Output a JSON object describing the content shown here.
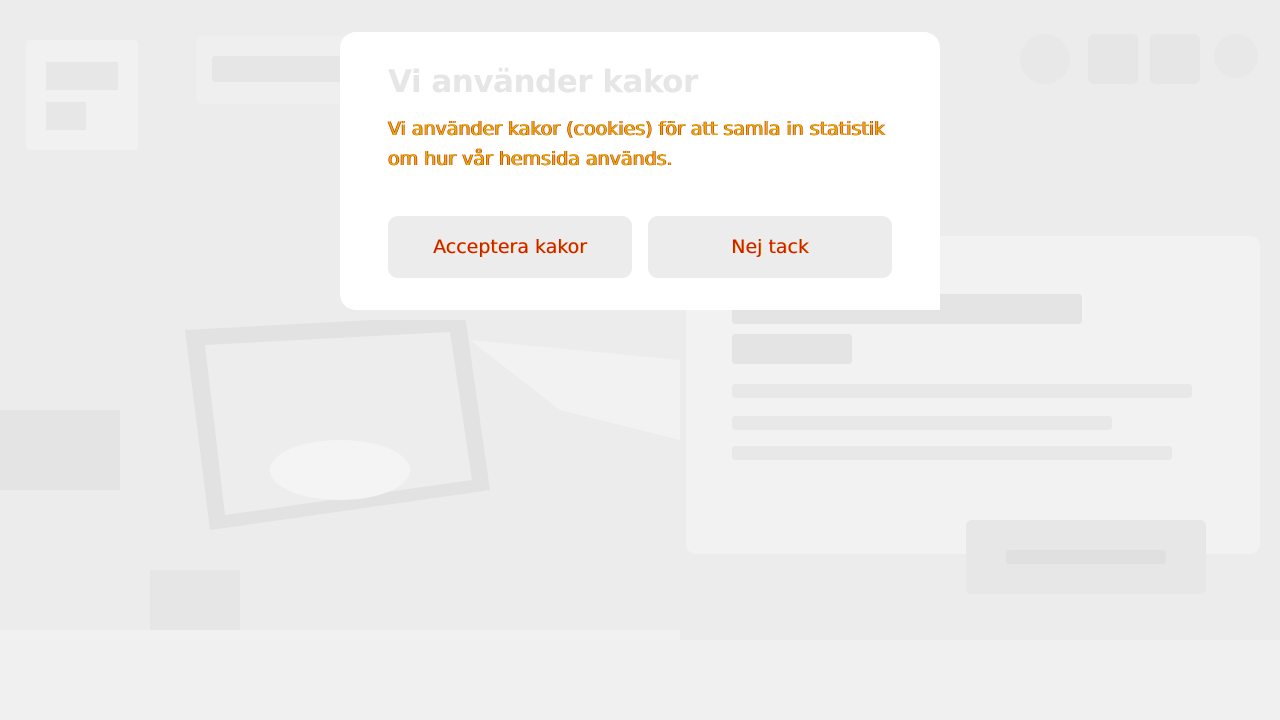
{
  "cookie_dialog": {
    "title": "Vi använder kakor",
    "text": "Vi använder kakor (cookies) för att samla in statistik om hur vår hemsida används.",
    "accept_label": "Acceptera kakor",
    "decline_label": "Nej tack"
  },
  "colors": {
    "overlay_background": "#ececec",
    "dialog_background": "#ffffff",
    "button_background": "#ececec",
    "text_yellow": "#e0b400",
    "text_red": "#d11a00"
  }
}
